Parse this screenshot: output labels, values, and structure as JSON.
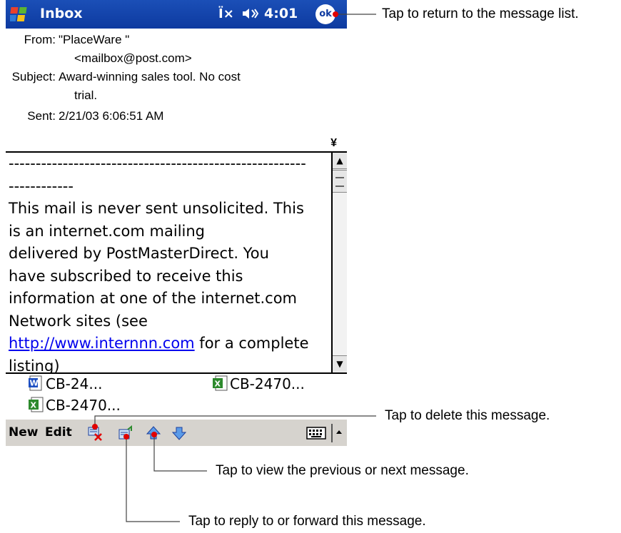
{
  "titlebar": {
    "app_title": "Inbox",
    "clock": "4:01",
    "ok_label": "ok"
  },
  "header": {
    "from_label": "From:",
    "from_name": "\"PlaceWare \"",
    "from_email": "<mailbox@post.com>",
    "subject_label": "Subject:",
    "subject_line1": "Award-winning sales tool. No cost",
    "subject_line2": "trial.",
    "sent_label": "Sent:",
    "sent_value": "2/21/03 6:06:51 AM"
  },
  "body": {
    "lines": [
      "-------------------------------------------------------",
      "------------",
      "This mail is never sent unsolicited. This",
      "is an internet.com mailing",
      "delivered by PostMasterDirect. You",
      "have subscribed to receive this",
      "information at one of the internet.com",
      "Network sites (see"
    ],
    "link_text": "http://www.internnn.com",
    "link_suffix": " for a complete",
    "last_line": "listing)"
  },
  "attachments": [
    {
      "name": "CB-24...",
      "type": "word"
    },
    {
      "name": "CB-2470...",
      "type": "excel"
    },
    {
      "name": "CB-2470...",
      "type": "excel"
    }
  ],
  "toolbar": {
    "new_label": "New",
    "edit_label": "Edit"
  },
  "callouts": {
    "ok": "Tap to return to the message list.",
    "delete": "Tap to delete this message.",
    "prevnext": "Tap to view the previous or next message.",
    "reply": "Tap to reply to or forward this message."
  },
  "colors": {
    "titlebar": "#0d3aa0",
    "callout_dot": "#e00000",
    "link": "#0000ee"
  }
}
